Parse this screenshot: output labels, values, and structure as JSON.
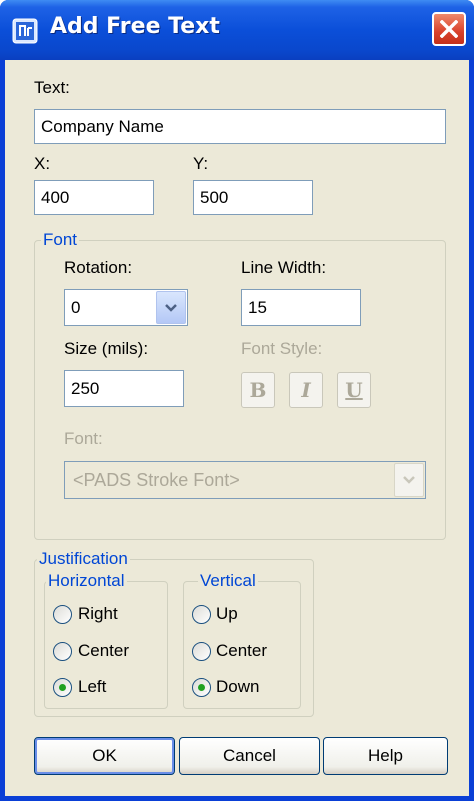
{
  "window": {
    "title": "Add Free Text"
  },
  "text_field": {
    "label": "Text:",
    "value": "Company Name"
  },
  "x_field": {
    "label": "X:",
    "value": "400"
  },
  "y_field": {
    "label": "Y:",
    "value": "500"
  },
  "font_group": {
    "title": "Font",
    "rotation": {
      "label": "Rotation:",
      "value": "0"
    },
    "line_width": {
      "label": "Line Width:",
      "value": "15"
    },
    "size": {
      "label": "Size (mils):",
      "value": "250"
    },
    "font_style": {
      "label": "Font Style:",
      "bold": "B",
      "italic": "I",
      "underline": "U"
    },
    "font": {
      "label": "Font:",
      "value": "<PADS Stroke Font>"
    }
  },
  "justification": {
    "title": "Justification",
    "horizontal": {
      "title": "Horizontal",
      "options": [
        "Right",
        "Center",
        "Left"
      ],
      "selected": "Left"
    },
    "vertical": {
      "title": "Vertical",
      "options": [
        "Up",
        "Center",
        "Down"
      ],
      "selected": "Down"
    }
  },
  "buttons": {
    "ok": "OK",
    "cancel": "Cancel",
    "help": "Help"
  },
  "colors": {
    "titlebar": "#0a47cc",
    "face": "#ece9d8",
    "group_label": "#0046d5",
    "radio_dot": "#21a121"
  }
}
